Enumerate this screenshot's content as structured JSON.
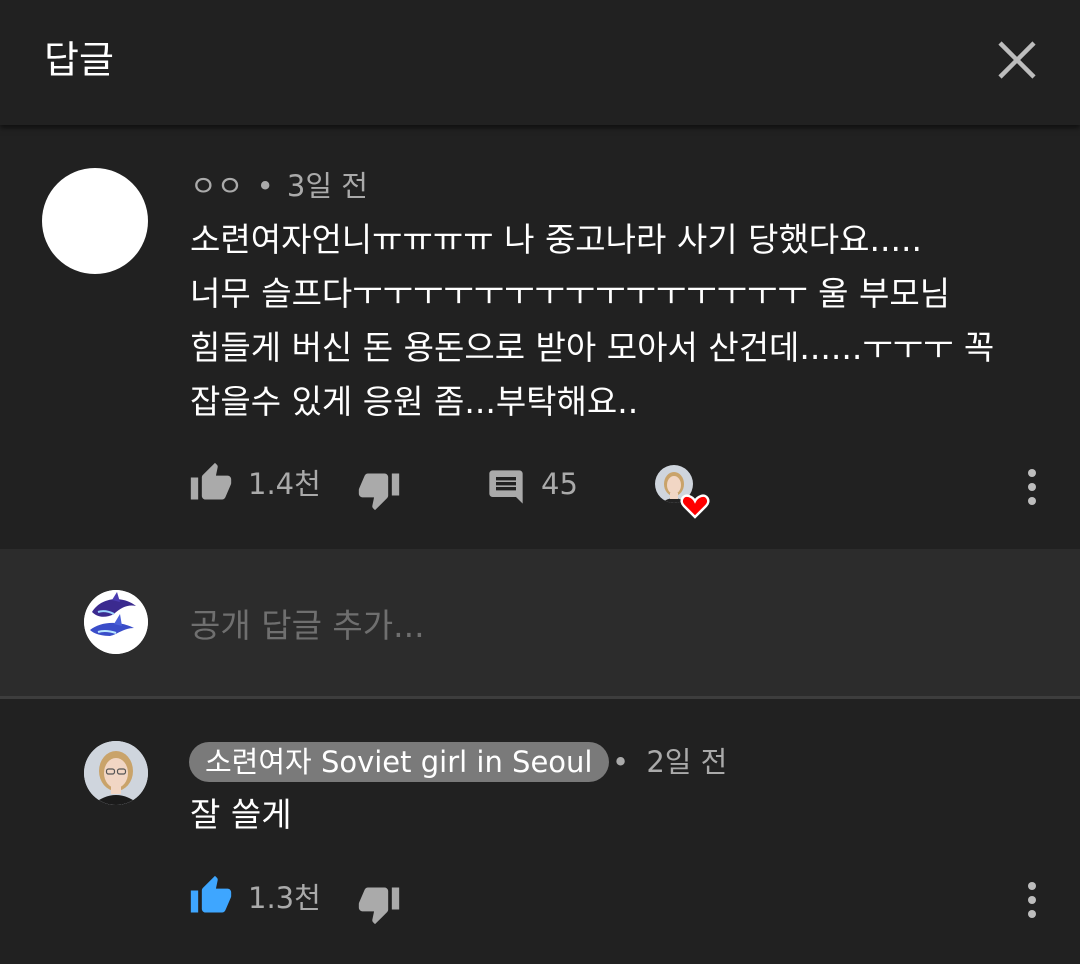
{
  "header": {
    "title": "답글",
    "close_icon": "close-icon"
  },
  "comment": {
    "author": "ㅇㅇ",
    "separator": "•",
    "time": "3일 전",
    "text_lines": [
      "소련여자언니ㅠㅠㅠㅠ 나 중고나라 사기 당했다요.....",
      "너무 슬프다ㅜㅜㅜㅜㅜㅜㅜㅜㅜㅜㅜㅜㅜㅜㅜ 울 부모님",
      "힘들게 버신 돈 용돈으로 받아 모아서 산건데......ㅜㅜㅜ 꼭",
      "잡을수 있게 응원 좀...부탁해요.."
    ],
    "like_count": "1.4천",
    "reply_count": "45",
    "hearted": true
  },
  "reply_input": {
    "placeholder": "공개 답글 추가..."
  },
  "reply": {
    "author": "소련여자 Soviet girl in Seoul",
    "separator": "•",
    "time": "2일 전",
    "text": "잘 쓸게",
    "like_count": "1.3천",
    "liked": true
  },
  "colors": {
    "background": "#212121",
    "input_background": "#2c2c2c",
    "secondary_text": "#aaaaaa",
    "like_active": "#3ea6ff",
    "heart": "#ff0000",
    "author_badge": "#7a7a7a"
  }
}
